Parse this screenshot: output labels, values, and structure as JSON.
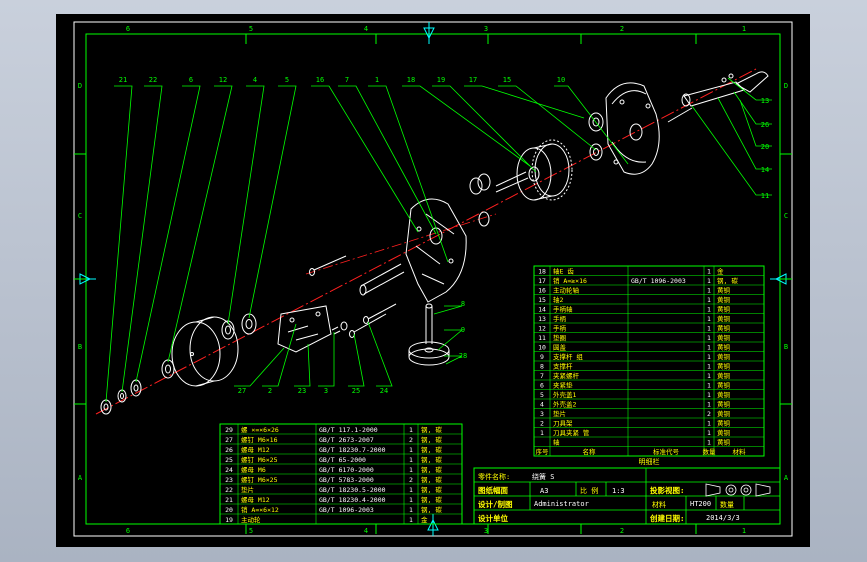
{
  "colors": {
    "background": "#000000",
    "frame": "#ffffff",
    "lines": "#00ff00",
    "part": "#ffffff",
    "axis": "#ff2020",
    "text_yellow": "#ffff00",
    "text_white": "#ffffff",
    "marker": "#00ffff"
  },
  "zones": {
    "cols": [
      "6",
      "5",
      "4",
      "3",
      "2",
      "1"
    ],
    "rows": [
      "D",
      "C",
      "B",
      "A"
    ]
  },
  "balloons_top": [
    "21",
    "22",
    "6",
    "12",
    "4",
    "5",
    "16",
    "7",
    "1",
    "18",
    "19",
    "17",
    "15",
    "10"
  ],
  "balloons_right": [
    "13",
    "26",
    "20",
    "14",
    "11"
  ],
  "balloons_mid": [
    "8",
    "9",
    "28"
  ],
  "balloons_bottom": [
    "27",
    "2",
    "23",
    "3",
    "25",
    "24"
  ],
  "bom_right": [
    {
      "no": "18",
      "name": "轴E 齿",
      "code": "",
      "qty": "1",
      "mat": "金"
    },
    {
      "no": "17",
      "name": "销 A=≥×16",
      "code": "GB/T 1096-2003",
      "qty": "1",
      "mat": "钢, 碳"
    },
    {
      "no": "16",
      "name": "主动轮轴",
      "code": "",
      "qty": "1",
      "mat": "黄铜"
    },
    {
      "no": "15",
      "name": "轴2",
      "code": "",
      "qty": "1",
      "mat": "黄铜"
    },
    {
      "no": "14",
      "name": "手柄轴",
      "code": "",
      "qty": "1",
      "mat": "黄铜"
    },
    {
      "no": "13",
      "name": "手柄",
      "code": "",
      "qty": "1",
      "mat": "黄铜"
    },
    {
      "no": "12",
      "name": "手柄",
      "code": "",
      "qty": "1",
      "mat": "黄铜"
    },
    {
      "no": "11",
      "name": "垫圈",
      "code": "",
      "qty": "1",
      "mat": "黄铜"
    },
    {
      "no": "10",
      "name": "圆盖",
      "code": "",
      "qty": "1",
      "mat": "黄铜"
    },
    {
      "no": "9",
      "name": "支撑杆 组",
      "code": "",
      "qty": "1",
      "mat": "黄铜"
    },
    {
      "no": "8",
      "name": "支撑杆",
      "code": "",
      "qty": "1",
      "mat": "黄铜"
    },
    {
      "no": "7",
      "name": "夹紧螺杆",
      "code": "",
      "qty": "1",
      "mat": "黄铜"
    },
    {
      "no": "6",
      "name": "夹紧垫",
      "code": "",
      "qty": "1",
      "mat": "黄铜"
    },
    {
      "no": "5",
      "name": "外壳盖1",
      "code": "",
      "qty": "1",
      "mat": "黄铜"
    },
    {
      "no": "4",
      "name": "外壳盖2",
      "code": "",
      "qty": "1",
      "mat": "黄铜"
    },
    {
      "no": "3",
      "name": "垫片",
      "code": "",
      "qty": "2",
      "mat": "黄铜"
    },
    {
      "no": "2",
      "name": "刀具架",
      "code": "",
      "qty": "1",
      "mat": "黄铜"
    },
    {
      "no": "1",
      "name": "刀具夹紧 管",
      "code": "",
      "qty": "1",
      "mat": "黄铜"
    },
    {
      "no": "",
      "name": "轴",
      "code": "",
      "qty": "1",
      "mat": "黄铜"
    }
  ],
  "bom_right_header": [
    "序号",
    "名称",
    "标准代号",
    "数量",
    "材料"
  ],
  "bom_right_caption": "明细栏",
  "bom_left": [
    {
      "no": "29",
      "name": "螺 ×=×6×26",
      "code": "GB/T 117.1-2000",
      "qty": "1",
      "mat": "钢, 碳"
    },
    {
      "no": "27",
      "name": "螺钉 M6×16",
      "code": "GB/T 2673-2007",
      "qty": "2",
      "mat": "钢, 碳"
    },
    {
      "no": "26",
      "name": "螺母 M12",
      "code": "GB/T 18230.7-2000",
      "qty": "1",
      "mat": "钢, 碳"
    },
    {
      "no": "25",
      "name": "螺钉 M6×25",
      "code": "GB/T 65-2000",
      "qty": "1",
      "mat": "钢, 碳"
    },
    {
      "no": "24",
      "name": "螺母 M6",
      "code": "GB/T 6170-2000",
      "qty": "1",
      "mat": "钢, 碳"
    },
    {
      "no": "23",
      "name": "螺钉 M6×25",
      "code": "GB/T 5783-2000",
      "qty": "2",
      "mat": "钢, 碳"
    },
    {
      "no": "22",
      "name": "垫片",
      "code": "GB/T 18230.5-2000",
      "qty": "1",
      "mat": "钢, 碳"
    },
    {
      "no": "21",
      "name": "螺母 M12",
      "code": "GB/T 18230.4-2000",
      "qty": "1",
      "mat": "钢, 碳"
    },
    {
      "no": "20",
      "name": "销 A=×6×12",
      "code": "GB/T 1096-2003",
      "qty": "1",
      "mat": "钢, 碳"
    },
    {
      "no": "19",
      "name": "主动轮",
      "code": "",
      "qty": "1",
      "mat": "金"
    }
  ],
  "title_block": {
    "part_name_label": "零件名称:",
    "part_name": "绕簧 S",
    "drawing_label": "图纸幅面",
    "drawing_size": "A3",
    "scale_label": "比 例",
    "scale": "1:3",
    "designer_label": "设计/制图",
    "designer": "Administrator",
    "unit_label": "设计单位",
    "proj_label": "投影视图:",
    "material_label": "材料",
    "material": "HT200",
    "qty_label": "数量",
    "date_label": "创建日期:",
    "date": "2014/3/3"
  }
}
